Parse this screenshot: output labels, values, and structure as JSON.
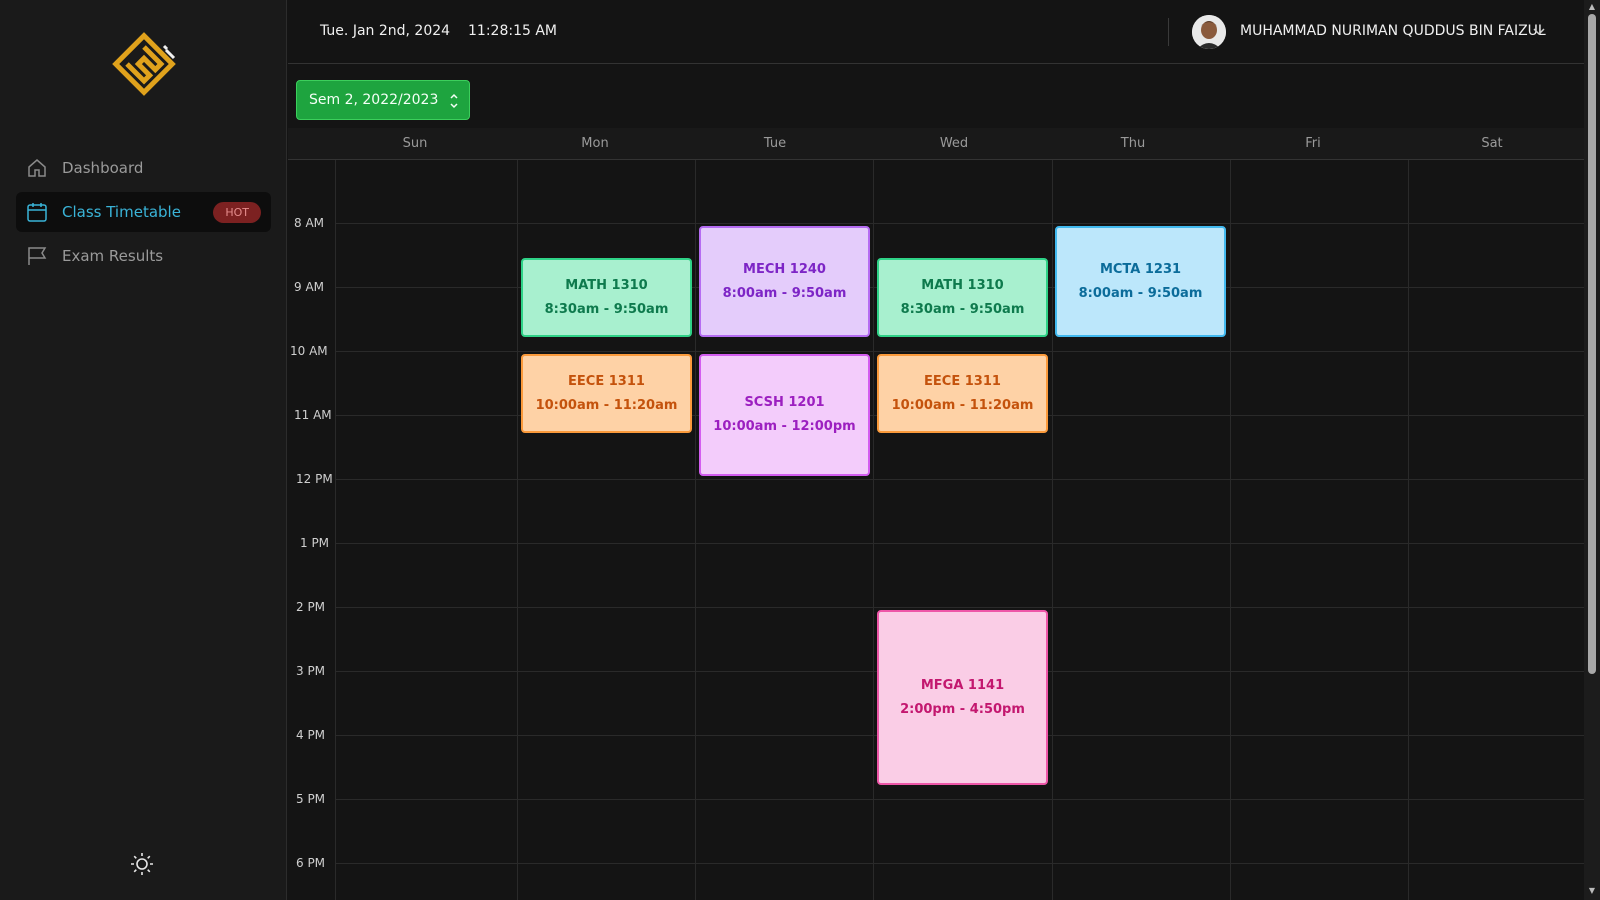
{
  "header": {
    "date": "Tue. Jan 2nd, 2024",
    "time": "11:28:15 AM",
    "user_name": "MUHAMMAD NURIMAN QUDDUS BIN FAIZUL"
  },
  "sidebar": {
    "items": [
      {
        "label": "Dashboard",
        "icon": "home-icon"
      },
      {
        "label": "Class Timetable",
        "icon": "calendar-icon",
        "badge": "HOT",
        "active": true
      },
      {
        "label": "Exam Results",
        "icon": "flag-icon"
      }
    ]
  },
  "semester": {
    "selected": "Sem 2, 2022/2023"
  },
  "calendar": {
    "days": [
      "Sun",
      "Mon",
      "Tue",
      "Wed",
      "Thu",
      "Fri",
      "Sat"
    ],
    "times": [
      "8 AM",
      "9 AM",
      "10 AM",
      "11 AM",
      "12 PM",
      "1 PM",
      "2 PM",
      "3 PM",
      "4 PM",
      "5 PM",
      "6 PM"
    ],
    "events": [
      {
        "code": "MATH 1310",
        "time": "8:30am - 9:50am",
        "day": "Mon",
        "color": "green"
      },
      {
        "code": "MECH 1240",
        "time": "8:00am - 9:50am",
        "day": "Tue",
        "color": "purple"
      },
      {
        "code": "MATH 1310",
        "time": "8:30am - 9:50am",
        "day": "Wed",
        "color": "green"
      },
      {
        "code": "MCTA 1231",
        "time": "8:00am - 9:50am",
        "day": "Thu",
        "color": "blue"
      },
      {
        "code": "EECE 1311",
        "time": "10:00am - 11:20am",
        "day": "Mon",
        "color": "orange"
      },
      {
        "code": "SCSH 1201",
        "time": "10:00am - 12:00pm",
        "day": "Tue",
        "color": "lilac"
      },
      {
        "code": "EECE 1311",
        "time": "10:00am - 11:20am",
        "day": "Wed",
        "color": "orange"
      },
      {
        "code": "MFGA 1141",
        "time": "2:00pm - 4:50pm",
        "day": "Wed",
        "color": "pink"
      }
    ]
  },
  "colors": {
    "accent": "#3ab4d8",
    "semester_button": "#1ea43f",
    "badge_bg": "#7c2121",
    "logo": "#e0a21c"
  }
}
